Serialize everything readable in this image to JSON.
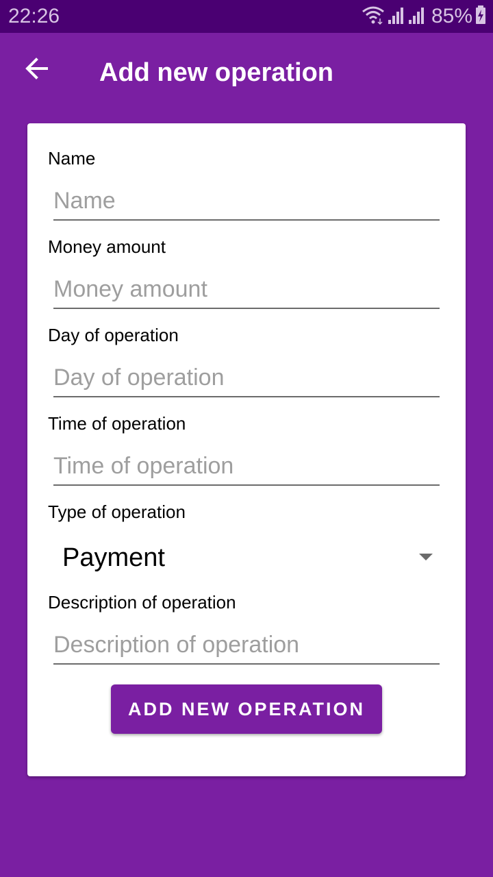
{
  "status_bar": {
    "time": "22:26",
    "battery": "85%",
    "icons": [
      "wifi-icon",
      "signal-icon",
      "signal-icon",
      "battery-charging-icon"
    ]
  },
  "app_bar": {
    "title": "Add new operation",
    "back_icon": "arrow-back-icon"
  },
  "form": {
    "name": {
      "label": "Name",
      "placeholder": "Name"
    },
    "money": {
      "label": "Money amount",
      "placeholder": "Money amount"
    },
    "day": {
      "label": "Day of operation",
      "placeholder": "Day of operation"
    },
    "time": {
      "label": "Time of operation",
      "placeholder": "Time of operation"
    },
    "type": {
      "label": "Type of operation",
      "selected": "Payment"
    },
    "description": {
      "label": "Description of operation",
      "placeholder": "Description of operation"
    },
    "submit_label": "ADD NEW OPERATION"
  },
  "colors": {
    "primary": "#7a1fa2",
    "primary_dark": "#4a0072",
    "card": "#ffffff",
    "hint": "#9e9e9e"
  }
}
